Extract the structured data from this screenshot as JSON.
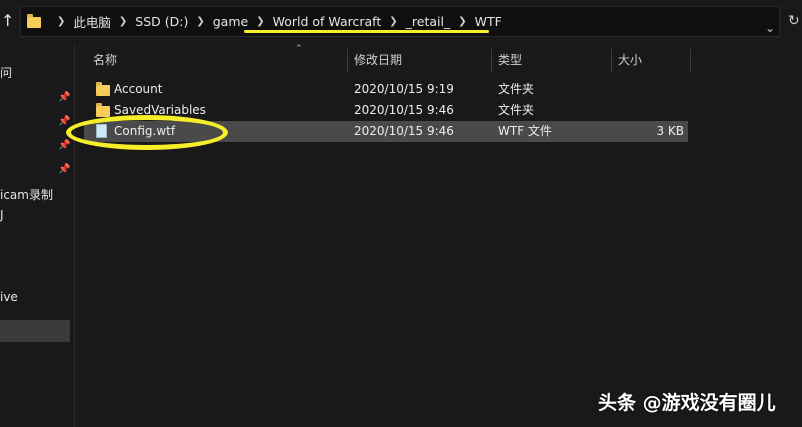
{
  "address_bar": {
    "crumbs": [
      "此电脑",
      "SSD (D:)",
      "game",
      "World of Warcraft",
      "_retail_",
      "WTF"
    ]
  },
  "nav_pane": {
    "fragments": [
      "问",
      "icam录制",
      "J",
      "ive"
    ]
  },
  "columns": {
    "name": "名称",
    "date": "修改日期",
    "type": "类型",
    "size": "大小"
  },
  "files": [
    {
      "name": "Account",
      "date": "2020/10/15 9:19",
      "type": "文件夹",
      "size": "",
      "kind": "folder"
    },
    {
      "name": "SavedVariables",
      "date": "2020/10/15 9:46",
      "type": "文件夹",
      "size": "",
      "kind": "folder"
    },
    {
      "name": "Config.wtf",
      "date": "2020/10/15 9:46",
      "type": "WTF 文件",
      "size": "3 KB",
      "kind": "file",
      "selected": true
    }
  ],
  "watermark": "头条 @游戏没有圈儿",
  "colors": {
    "highlight_annotation": "#f7ee2a",
    "folder": "#f6cd5a",
    "selection": "#4a4a4a"
  }
}
